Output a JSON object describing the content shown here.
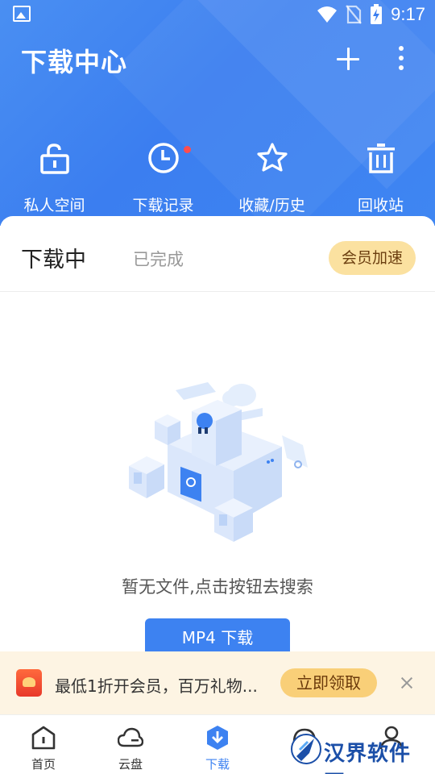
{
  "status_bar": {
    "time": "9:17"
  },
  "header": {
    "title": "下载中心",
    "quick_actions": [
      {
        "label": "私人空间",
        "icon": "unlock-icon"
      },
      {
        "label": "下载记录",
        "icon": "clock-icon",
        "has_badge": true
      },
      {
        "label": "收藏/历史",
        "icon": "star-icon"
      },
      {
        "label": "回收站",
        "icon": "trash-icon"
      }
    ]
  },
  "tabs": {
    "active": "下载中",
    "inactive": "已完成"
  },
  "vip_button": "会员加速",
  "empty_state": {
    "message": "暂无文件,点击按钮去搜索",
    "button": "MP4 下载"
  },
  "promo": {
    "text": "最低1折开会员，百万礼物...",
    "button": "立即领取"
  },
  "bottom_nav": [
    {
      "label": "首页",
      "icon": "home-icon"
    },
    {
      "label": "云盘",
      "icon": "cloud-icon"
    },
    {
      "label": "下载",
      "icon": "download-icon",
      "active": true
    },
    {
      "label": "",
      "icon": "speed-icon"
    },
    {
      "label": "",
      "icon": "profile-icon"
    }
  ],
  "watermark": {
    "text": "汉界软件园"
  },
  "colors": {
    "primary": "#3d82f1",
    "vip": "#fbe1a0",
    "promo_bg": "#fdf4e3"
  }
}
